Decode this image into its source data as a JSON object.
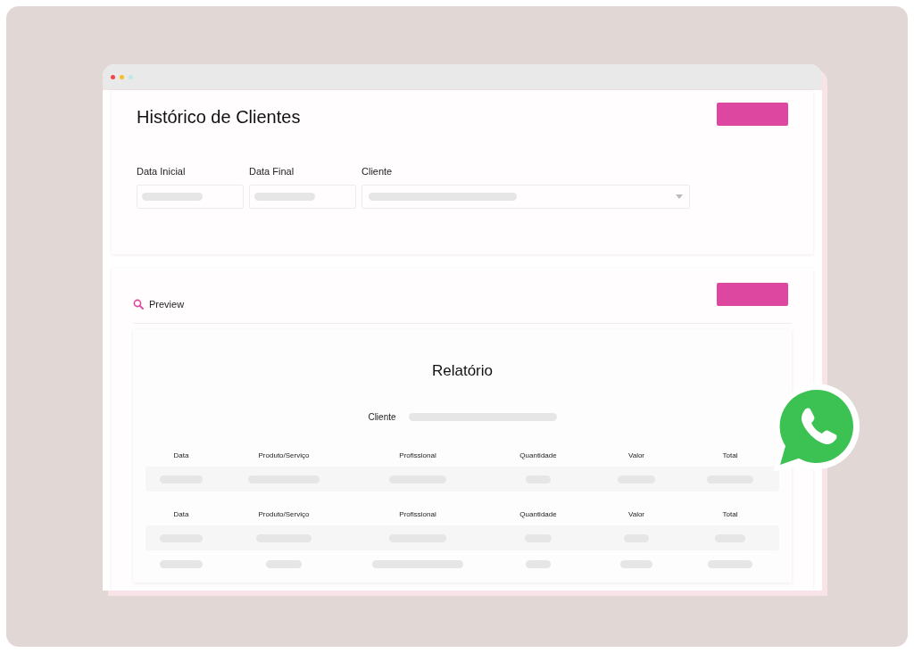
{
  "page_title": "Histórico de Clientes",
  "filters": [
    {
      "label": "Data Inicial",
      "kind": "input"
    },
    {
      "label": "Data Final",
      "kind": "input"
    },
    {
      "label": "Cliente",
      "kind": "select"
    }
  ],
  "preview": {
    "label": "Preview"
  },
  "report": {
    "title": "Relatório",
    "client_label": "Cliente",
    "tables": [
      {
        "columns": [
          "Data",
          "Produto/Serviço",
          "Profissional",
          "Quantidade",
          "Valor",
          "Total"
        ]
      },
      {
        "columns": [
          "Data",
          "Produto/Serviço",
          "Profissional",
          "Quantidade",
          "Valor",
          "Total"
        ]
      }
    ]
  }
}
